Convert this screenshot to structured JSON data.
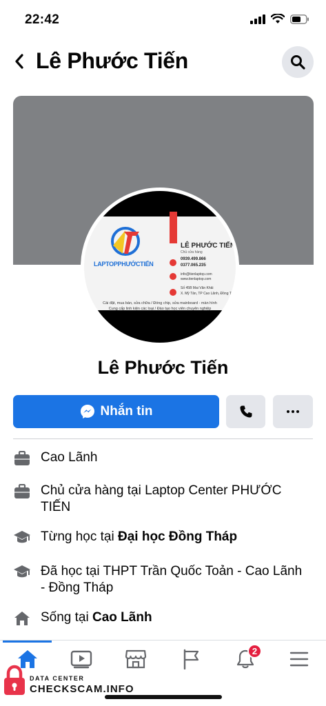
{
  "status_bar": {
    "time": "22:42"
  },
  "header": {
    "title": "Lê Phước Tiến"
  },
  "business_card": {
    "logo_text": "LAPTOPPHƯỚCTIẾN",
    "name": "LÊ PHƯỚC TIẾN",
    "role": "Chủ cửa hàng",
    "phone1": "0939.499.866",
    "phone2": "0377.065.235",
    "email": "info@tienlaptop.com",
    "website": "www.tienlaptop.com",
    "address1": "Số 45B Mai Văn Khải",
    "address2": "X. Mỹ Tân, TP Cao Lãnh, Đồng Thá",
    "service1": "Cài đặt, mua bán, sửa chữa / Đóng chip, sửa mainboard - màn hình",
    "service2": "Cung cấp linh kiện các loại / Đào tạo học viên chuyên nghiệp"
  },
  "profile": {
    "name": "Lê Phước Tiến"
  },
  "actions": {
    "message_label": "Nhắn tin"
  },
  "info_items": [
    {
      "icon": "briefcase-icon",
      "text": "Cao Lãnh"
    },
    {
      "icon": "briefcase-icon",
      "text": "Chủ cửa hàng tại Laptop Center  PHƯỚC TIẾN"
    },
    {
      "icon": "graduation-cap-icon",
      "prefix": "Từng học tại ",
      "bold": "Đại học Đồng Tháp"
    },
    {
      "icon": "graduation-cap-icon",
      "text": "Đã học tại THPT Trần Quốc Toản - Cao Lãnh - Đồng Tháp"
    },
    {
      "icon": "house-icon",
      "prefix": "Sống tại ",
      "bold": "Cao Lãnh"
    }
  ],
  "tabbar": {
    "notification_count": "2"
  },
  "watermark": {
    "small": "DATA CENTER",
    "big": "CHECKSCAM.INFO"
  },
  "colors": {
    "accent": "#1b74e4",
    "cover": "#7f8184",
    "badge": "#e41e3f",
    "button_gray": "#e4e6eb"
  }
}
